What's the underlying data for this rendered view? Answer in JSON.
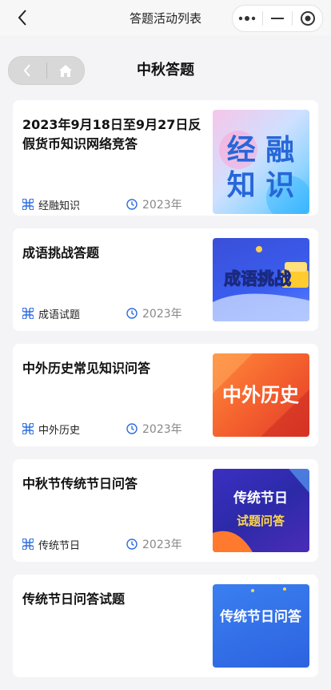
{
  "topbar": {
    "title": "答题活动列表"
  },
  "header": {
    "title": "中秋答题"
  },
  "cards": [
    {
      "title": "2023年9月18日至9月27日反假货币知识网络竞答",
      "category": "经融知识",
      "year": "2023年",
      "thumb_text_1": "经  融",
      "thumb_text_2": "知  识"
    },
    {
      "title": "成语挑战答题",
      "category": "成语试题",
      "year": "2023年",
      "thumb_text_1": "成语挑战"
    },
    {
      "title": "中外历史常见知识问答",
      "category": "中外历史",
      "year": "2023年",
      "thumb_text_1": "中外历史"
    },
    {
      "title": "中秋节传统节日问答",
      "category": "传统节日",
      "year": "2023年",
      "thumb_text_1": "传统节日",
      "thumb_text_2": "试题问答"
    },
    {
      "title": "传统节日问答试题",
      "thumb_text_1": "传统节日问答"
    }
  ],
  "colors": {
    "accent": "#2b6de0"
  }
}
